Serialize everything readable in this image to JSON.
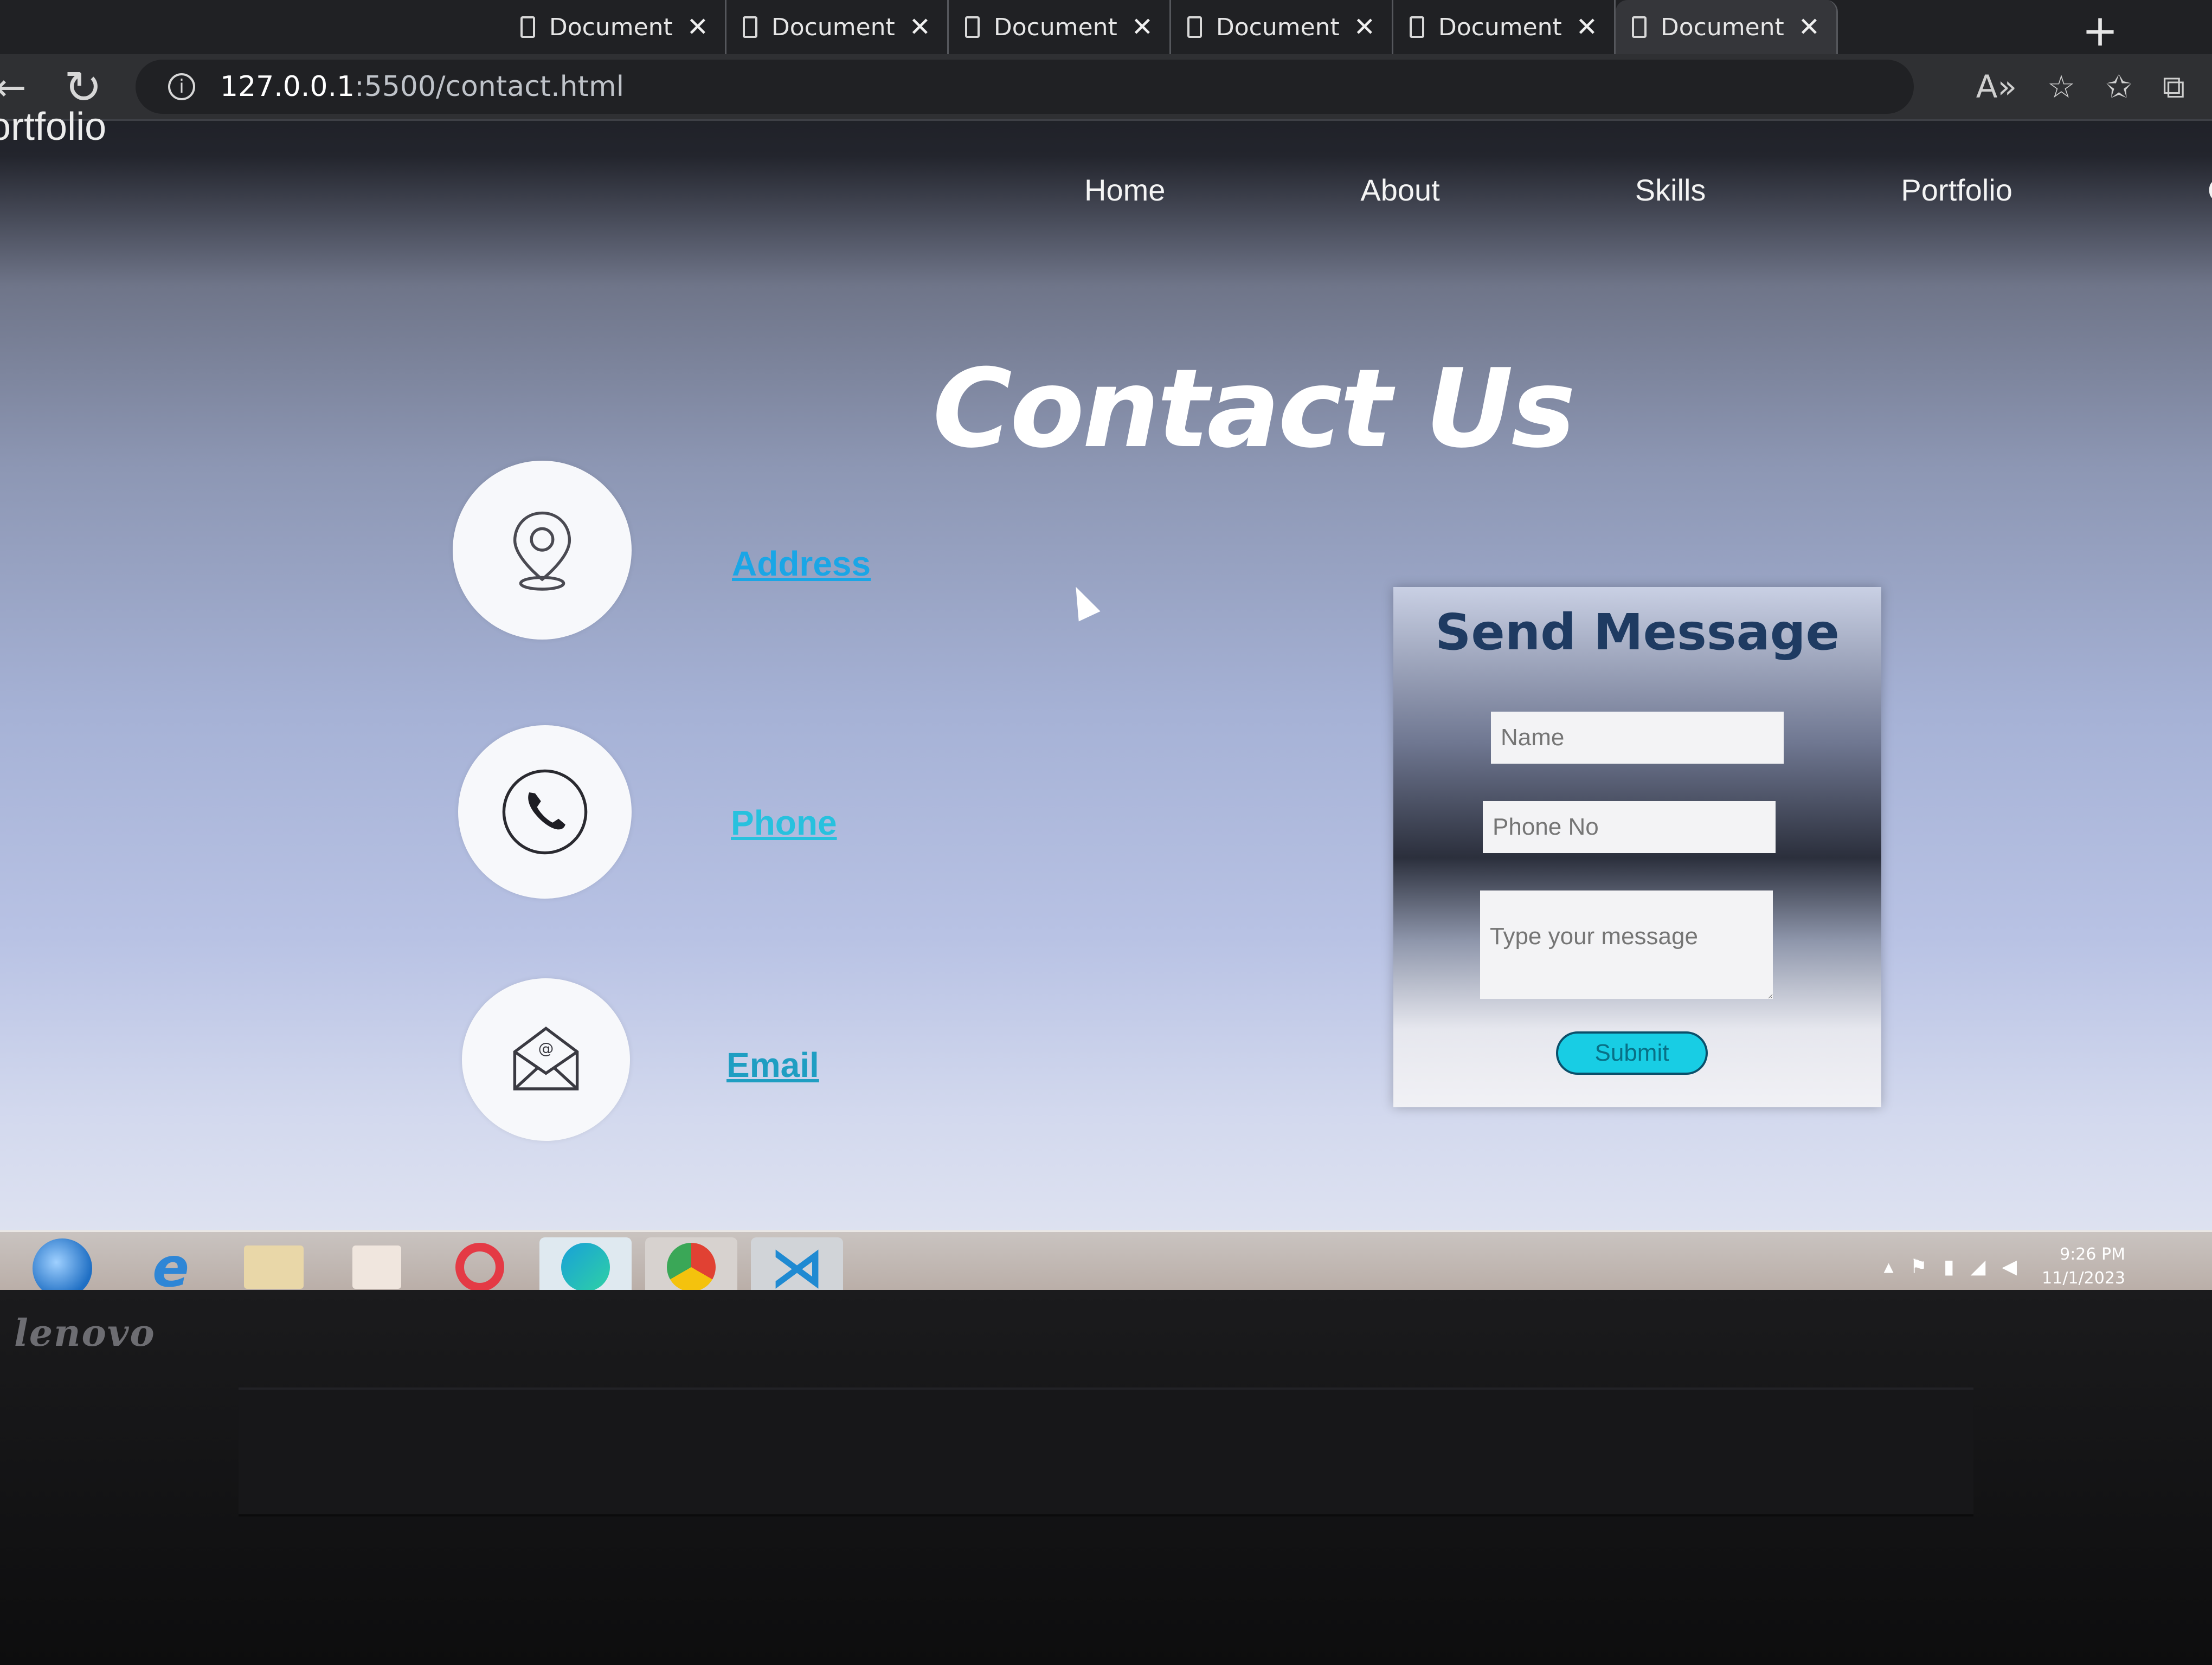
{
  "browser": {
    "tabs": [
      {
        "label": "Document"
      },
      {
        "label": "Document"
      },
      {
        "label": "Document"
      },
      {
        "label": "Document"
      },
      {
        "label": "Document"
      },
      {
        "label": "Document"
      }
    ],
    "url_host": "127.0.0.1",
    "url_rest": ":5500/contact.html"
  },
  "site": {
    "logo": "ortfolio",
    "nav": [
      "Home",
      "About",
      "Skills",
      "Portfolio",
      "Con"
    ],
    "title": "Contact Us",
    "contacts": [
      {
        "icon": "location-pin-icon",
        "label": "Address",
        "color": "#1aa6e6"
      },
      {
        "icon": "phone-icon",
        "label": "Phone",
        "color": "#27c1de"
      },
      {
        "icon": "email-envelope-icon",
        "label": "Email",
        "color": "#1f9ec2"
      }
    ],
    "form": {
      "heading": "Send Message",
      "name_placeholder": "Name",
      "phone_placeholder": "Phone No",
      "message_placeholder": "Type your message",
      "submit_label": "Submit"
    }
  },
  "taskbar": {
    "time": "9:26 PM",
    "date": "11/1/2023"
  },
  "device": {
    "brand": "lenovo"
  }
}
